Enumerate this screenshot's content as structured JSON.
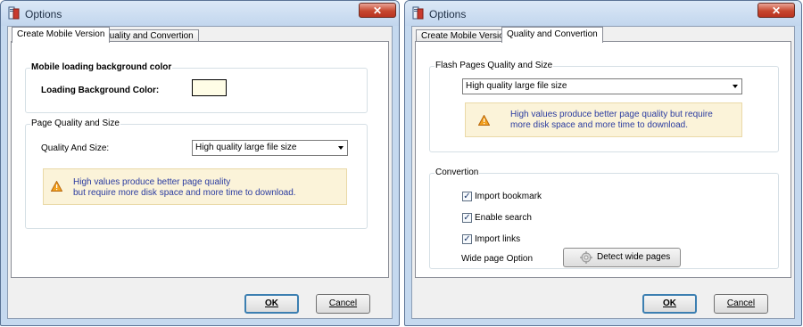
{
  "dialogs": [
    {
      "title": "Options",
      "close_glyph": "✕",
      "tabs": [
        "Create Mobile Version",
        "Quality and Convertion"
      ],
      "active_tab": "Create Mobile Version",
      "mobile_group": {
        "title": "Mobile loading background color",
        "label": "Loading Background Color:",
        "color": "#FFFDE6"
      },
      "quality_group": {
        "title": "Page Quality and Size",
        "label": "Quality And Size:",
        "select_value": "High quality large file size",
        "notice": [
          "High values produce better page quality",
          "but require more disk space and more time to download."
        ]
      },
      "ok_label": "OK",
      "cancel_label": "Cancel"
    },
    {
      "title": "Options",
      "close_glyph": "✕",
      "tabs": [
        "Create Mobile Version",
        "Quality and Convertion"
      ],
      "active_tab": "Quality and Convertion",
      "flash_group": {
        "title": "Flash Pages Quality and Size",
        "select_value": "High quality large file size",
        "notice": [
          "High values produce better page quality but require",
          "more disk space and more time to download."
        ]
      },
      "convertion_group": {
        "title": "Convertion",
        "options": [
          {
            "label": "Import bookmark",
            "checked": true
          },
          {
            "label": "Enable search",
            "checked": true
          },
          {
            "label": "Import links",
            "checked": true
          }
        ],
        "wide_page_label": "Wide page Option",
        "detect_label": "Detect wide pages"
      },
      "ok_label": "OK",
      "cancel_label": "Cancel"
    }
  ],
  "icons": {
    "app": "app-icon",
    "warning": "warning-icon",
    "detect": "gear-icon",
    "close": "close-icon"
  },
  "colors": {
    "notice_text": "#2A3BA0",
    "notice_bg": "#FBF3D9",
    "frame": "#C5D9EF",
    "close_red": "#C7472F"
  }
}
